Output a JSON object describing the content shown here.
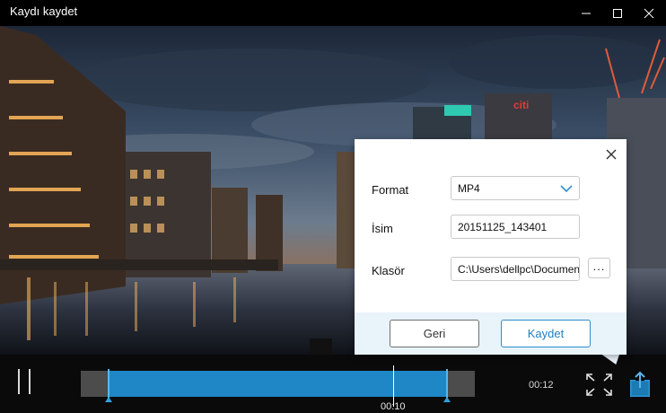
{
  "window": {
    "title": "Kaydı kaydet",
    "minimize_icon": "minimize-icon",
    "maximize_icon": "maximize-icon",
    "close_icon": "close-icon"
  },
  "dialog": {
    "format_label": "Format",
    "format_value": "MP4",
    "name_label": "İsim",
    "name_value": "20151125_143401",
    "folder_label": "Klasör",
    "folder_value": "C:\\Users\\dellpc\\Documents",
    "browse_label": "...",
    "back_button": "Geri",
    "save_button": "Kaydet"
  },
  "player": {
    "current_time": "00:10",
    "duration": "00:12",
    "progress_fraction": 0.83,
    "selection_start_fraction": 0.0,
    "selection_end_fraction": 1.0
  },
  "colors": {
    "accent": "#1f87c5",
    "footer_bg": "#e8f3fa",
    "save_text": "#1f7ec2"
  },
  "video_scene": {
    "billboard_text": "citi"
  }
}
